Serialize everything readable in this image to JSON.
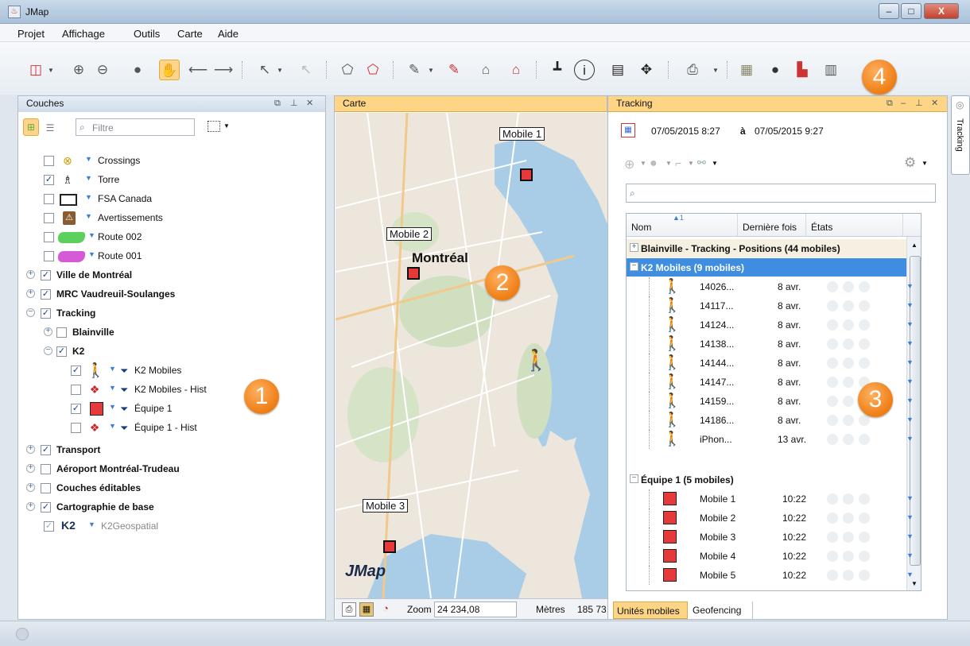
{
  "window": {
    "title": "JMap",
    "minimize": "–",
    "maximize": "□",
    "close": "X"
  },
  "menu": [
    "Projet",
    "Affichage",
    "Outils",
    "Carte",
    "Aide"
  ],
  "toolbar": {
    "badge": "4"
  },
  "layers": {
    "title": "Couches",
    "filter_placeholder": "Filtre",
    "badge": "1",
    "items": [
      {
        "label": "Crossings",
        "checked": false
      },
      {
        "label": "Torre",
        "checked": true
      },
      {
        "label": "FSA Canada",
        "checked": false
      },
      {
        "label": "Avertissements",
        "checked": false
      },
      {
        "label": "Route 002",
        "checked": false
      },
      {
        "label": "Route 001",
        "checked": false
      },
      {
        "label": "Ville de Montréal",
        "checked": true
      },
      {
        "label": "MRC Vaudreuil-Soulanges",
        "checked": true
      },
      {
        "label": "Tracking",
        "checked": true
      },
      {
        "label": "Blainville",
        "checked": false
      },
      {
        "label": "K2",
        "checked": true
      },
      {
        "label": "K2 Mobiles",
        "checked": true
      },
      {
        "label": "K2 Mobiles - Hist",
        "checked": false
      },
      {
        "label": "Équipe 1",
        "checked": true
      },
      {
        "label": "Équipe 1 - Hist",
        "checked": false
      },
      {
        "label": "Transport",
        "checked": true
      },
      {
        "label": "Aéroport Montréal-Trudeau",
        "checked": false
      },
      {
        "label": "Couches éditables",
        "checked": false
      },
      {
        "label": "Cartographie de base",
        "checked": true
      },
      {
        "label": "K2Geospatial",
        "checked": true
      }
    ],
    "k2_logo": "K2"
  },
  "map": {
    "title": "Carte",
    "labels": {
      "mobile1": "Mobile 1",
      "mobile2": "Mobile 2",
      "mobile3": "Mobile 3",
      "city": "Montréal"
    },
    "logo": "JMap",
    "badge": "2",
    "zoom_label": "Zoom",
    "zoom_value": "24 234,08",
    "units": "Mètres",
    "scale": "185 73"
  },
  "tracking": {
    "title": "Tracking",
    "side_tab": "Tracking",
    "date_from": "07/05/2015  8:27",
    "date_sep": "à",
    "date_to": "07/05/2015  9:27",
    "search_placeholder": "",
    "sort_indicator": "1",
    "columns": [
      "Nom",
      "Dernière fois",
      "États"
    ],
    "groups": {
      "g1": "Blainville - Tracking - Positions (44 mobiles)",
      "g2": "K2 Mobiles (9 mobiles)",
      "g3": "Équipe 1 (5 mobiles)"
    },
    "k2_rows": [
      {
        "name": "14026...",
        "time": "8 avr."
      },
      {
        "name": "14117...",
        "time": "8 avr."
      },
      {
        "name": "14124...",
        "time": "8 avr."
      },
      {
        "name": "14138...",
        "time": "8 avr."
      },
      {
        "name": "14144...",
        "time": "8 avr."
      },
      {
        "name": "14147...",
        "time": "8 avr."
      },
      {
        "name": "14159...",
        "time": "8 avr."
      },
      {
        "name": "14186...",
        "time": "8 avr."
      },
      {
        "name": "iPhon...",
        "time": "13 avr."
      }
    ],
    "equipe_rows": [
      {
        "name": "Mobile 1",
        "time": "10:22"
      },
      {
        "name": "Mobile 2",
        "time": "10:22"
      },
      {
        "name": "Mobile 3",
        "time": "10:22"
      },
      {
        "name": "Mobile 4",
        "time": "10:22"
      },
      {
        "name": "Mobile 5",
        "time": "10:22"
      }
    ],
    "badge": "3",
    "tabs": [
      "Unités mobiles",
      "Geofencing"
    ]
  }
}
